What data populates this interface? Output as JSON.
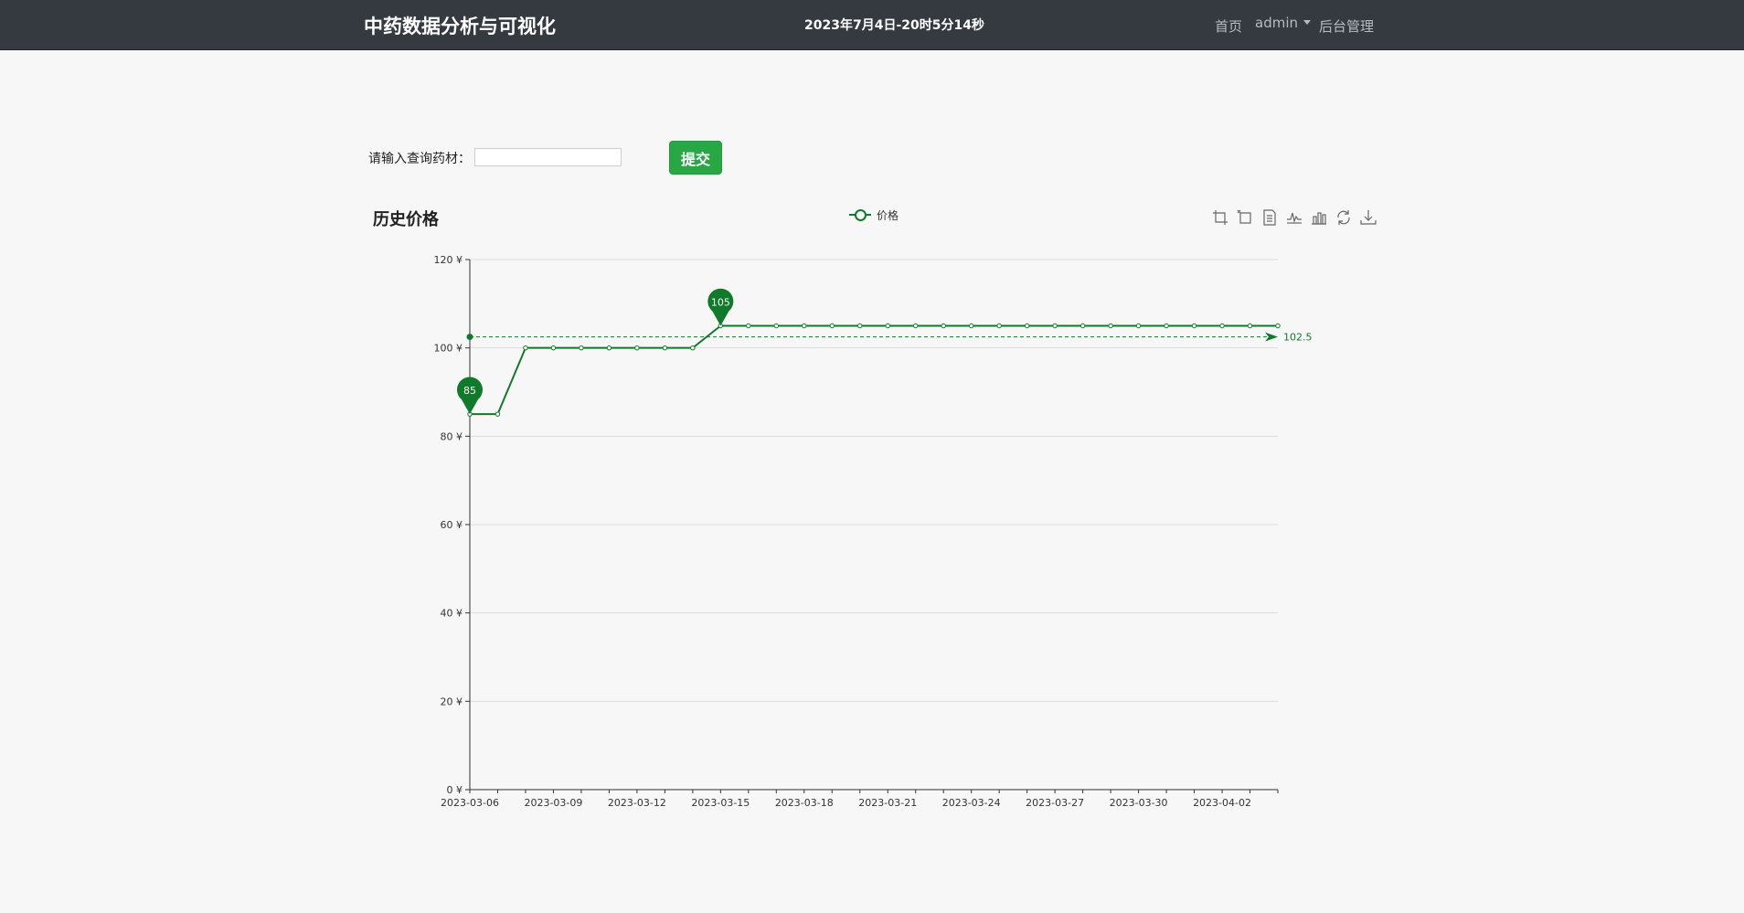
{
  "header": {
    "brand": "中药数据分析与可视化",
    "datetime": "2023年7月4日-20时5分14秒",
    "nav": {
      "home": "首页",
      "user": "admin",
      "backend": "后台管理"
    }
  },
  "query": {
    "label": "请输入查询药材：",
    "input_value": "",
    "submit_label": "提交"
  },
  "toolbox": [
    "zoom-icon",
    "zoom-reset-icon",
    "data-view-icon",
    "line-chart-icon",
    "bar-chart-icon",
    "restore-icon",
    "save-image-icon"
  ],
  "chart_data": {
    "type": "line",
    "title": "历史价格",
    "legend": {
      "entries": [
        "价格"
      ],
      "position": "top-center"
    },
    "series": [
      {
        "name": "价格",
        "color": "#0f7a2a",
        "values": [
          85,
          85,
          100,
          100,
          100,
          100,
          100,
          100,
          100,
          105,
          105,
          105,
          105,
          105,
          105,
          105,
          105,
          105,
          105,
          105,
          105,
          105,
          105,
          105,
          105,
          105,
          105,
          105,
          105,
          105
        ]
      }
    ],
    "x": [
      "2023-03-06",
      "2023-03-07",
      "2023-03-08",
      "2023-03-09",
      "2023-03-10",
      "2023-03-11",
      "2023-03-12",
      "2023-03-13",
      "2023-03-14",
      "2023-03-15",
      "2023-03-16",
      "2023-03-17",
      "2023-03-18",
      "2023-03-19",
      "2023-03-20",
      "2023-03-21",
      "2023-03-22",
      "2023-03-23",
      "2023-03-24",
      "2023-03-25",
      "2023-03-26",
      "2023-03-27",
      "2023-03-28",
      "2023-03-29",
      "2023-03-30",
      "2023-03-31",
      "2023-04-01",
      "2023-04-02",
      "2023-04-03",
      "2023-04-04"
    ],
    "x_tick_labels": [
      "2023-03-06",
      "2023-03-09",
      "2023-03-12",
      "2023-03-15",
      "2023-03-18",
      "2023-03-21",
      "2023-03-24",
      "2023-03-27",
      "2023-03-30",
      "2023-04-02"
    ],
    "y_ticks": [
      0,
      20,
      40,
      60,
      80,
      100,
      120
    ],
    "y_unit_suffix": " ¥",
    "ylim": [
      0,
      120
    ],
    "grid": "horizontal",
    "mark_points": [
      {
        "label": "85",
        "x": "2023-03-06",
        "value": 85
      },
      {
        "label": "105",
        "x": "2023-03-15",
        "value": 105
      }
    ],
    "mark_line": {
      "type": "average",
      "value": 102.5,
      "label": "102.5"
    }
  }
}
